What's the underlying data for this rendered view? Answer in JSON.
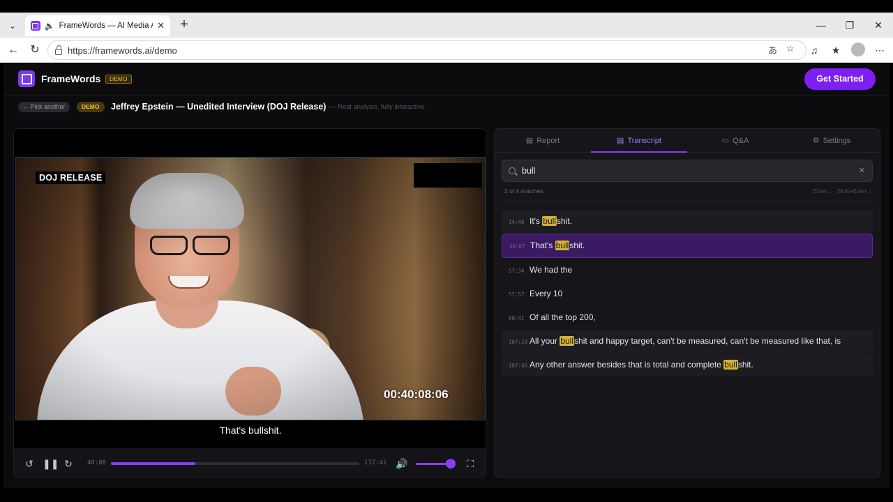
{
  "browser": {
    "tab_title": "FrameWords — AI Media Ana",
    "url": "https://framewords.ai/demo"
  },
  "header": {
    "brand": "FrameWords",
    "badge": "DEMO",
    "cta": "Get Started"
  },
  "subbar": {
    "back": "← Pick another",
    "chip": "DEMO",
    "title": "Jeffrey Epstein — Unedited Interview (DOJ Release)",
    "tagline": "— Real analysis, fully interactive"
  },
  "video": {
    "overlay_label": "DOJ RELEASE",
    "timecode": "00:40:08:06",
    "caption": "That's bullshit.",
    "current_time": "40:08",
    "duration": "117:41",
    "progress_fraction": 0.34,
    "volume_fraction": 0.9
  },
  "panel": {
    "tabs": [
      {
        "label": "Report",
        "icon": "bar-chart-icon"
      },
      {
        "label": "Transcript",
        "icon": "document-icon"
      },
      {
        "label": "Q&A",
        "icon": "chat-icon"
      },
      {
        "label": "Settings",
        "icon": "gear-icon"
      }
    ],
    "active_tab": "Transcript",
    "search_value": "bull",
    "match_count": "2 of 4 matches",
    "shortcut_hint": "Enter ↓ · Shift+Enter ↑",
    "results": [
      {
        "ts": "14:46",
        "pre": "It's ",
        "match": "bull",
        "post": "shit.",
        "state": "soft"
      },
      {
        "ts": "40:07",
        "pre": "That's ",
        "match": "bull",
        "post": "shit.",
        "state": "active"
      },
      {
        "ts": "57:34",
        "pre": "We had the",
        "match": "",
        "post": "",
        "state": "none"
      },
      {
        "ts": "57:57",
        "pre": "Every 10",
        "match": "",
        "post": "",
        "state": "none"
      },
      {
        "ts": "60:41",
        "pre": "Of all the top 200,",
        "match": "",
        "post": "",
        "state": "none"
      },
      {
        "ts": "107:20",
        "pre": "All your ",
        "match": "bull",
        "post": "shit and happy target, can't be measured, can't be measured like that, is",
        "state": "soft"
      },
      {
        "ts": "107:46",
        "pre": "Any other answer besides that is total and complete ",
        "match": "bull",
        "post": "shit.",
        "state": "soft"
      }
    ]
  },
  "colors": {
    "accent": "#7c1ff0",
    "highlight": "#d6b232",
    "active_row": "#3b1a64"
  }
}
